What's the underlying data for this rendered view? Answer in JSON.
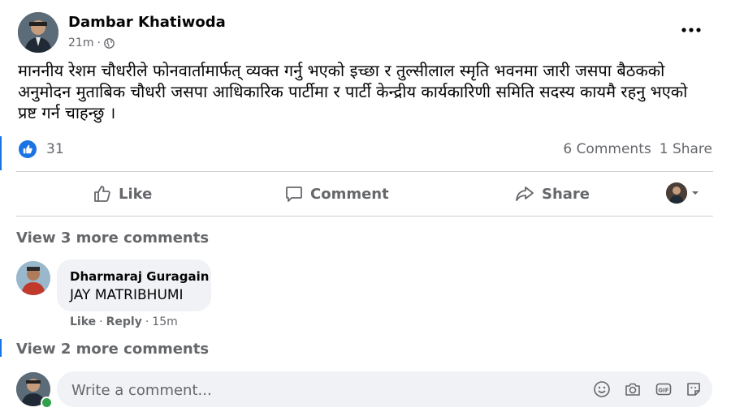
{
  "post": {
    "author": "Dambar Khatiwoda",
    "time": "21m",
    "separator": "·",
    "text": "माननीय रेशम चौधरीले फोनवार्तामार्फत् व्यक्त गर्नु भएको इच्छा र तुल्सीलाल स्मृति भवनमा जारी जसपा बैठकको अनुमोदन मुताबिक चौधरी जसपा आधिकारिक पार्टीमा र पार्टी केन्द्रीय कार्यकारिणी समिति सदस्य कायमै रहनु भएको प्रष्ट गर्न चाहन्छु ।",
    "more_icon": "more-options-icon",
    "privacy_icon": "globe-icon"
  },
  "stats": {
    "likes": "31",
    "comments": "6 Comments",
    "shares": "1 Share"
  },
  "actions": {
    "like": "Like",
    "comment": "Comment",
    "share": "Share"
  },
  "comments_section": {
    "view_more_top": "View 3 more comments",
    "view_more_bottom": "View 2 more comments",
    "comment": {
      "author": "Dharmaraj Guragain",
      "text": "JAY MATRIBHUMI",
      "like_label": "Like",
      "reply_label": "Reply",
      "dot": "·",
      "time": "15m"
    }
  },
  "composer": {
    "placeholder": "Write a comment..."
  },
  "colors": {
    "accent": "#1b74e4",
    "secondary_text": "#65676b",
    "bubble_bg": "#f0f2f5",
    "online": "#31a24c"
  }
}
